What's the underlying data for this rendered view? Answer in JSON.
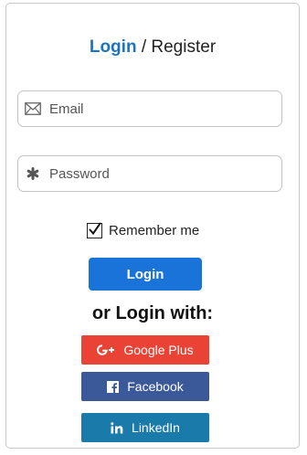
{
  "tabs": {
    "login": "Login",
    "separator": " / ",
    "register": "Register"
  },
  "fields": {
    "email": {
      "placeholder": "Email",
      "value": ""
    },
    "password": {
      "placeholder": "Password",
      "value": ""
    }
  },
  "remember": {
    "label": "Remember me",
    "checked": true
  },
  "login_button": "Login",
  "or_text": "or Login with:",
  "social": {
    "google": {
      "label": "Google Plus",
      "icon": "google-plus-icon",
      "color": "#ea4335"
    },
    "facebook": {
      "label": "Facebook",
      "icon": "facebook-icon",
      "color": "#3b5998"
    },
    "linkedin": {
      "label": "LinkedIn",
      "icon": "linkedin-icon",
      "color": "#1a7bab"
    }
  },
  "colors": {
    "accent": "#1e73be",
    "login_button": "#1a73d9"
  }
}
